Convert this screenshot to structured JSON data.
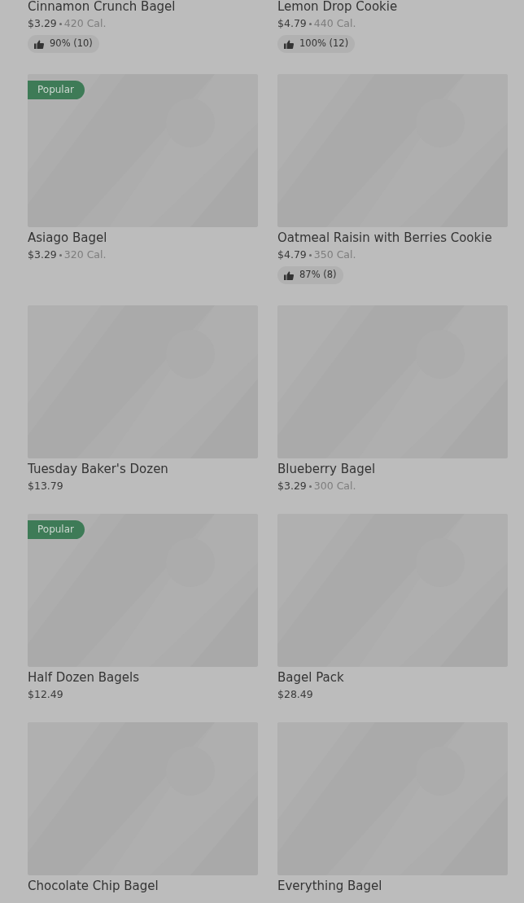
{
  "items": [
    {
      "name": "Cinnamon Crunch Bagel",
      "price": "$3.29",
      "calories": "420 Cal.",
      "rating": "90% (10)"
    },
    {
      "name": "Lemon Drop Cookie",
      "price": "$4.79",
      "calories": "440 Cal.",
      "rating": "100% (12)"
    },
    {
      "badge": "Popular",
      "name": "Asiago Bagel",
      "price": "$3.29",
      "calories": "320 Cal."
    },
    {
      "name": "Oatmeal Raisin with Berries Cookie",
      "price": "$4.79",
      "calories": "350 Cal.",
      "rating": "87% (8)"
    },
    {
      "name": "Tuesday Baker's Dozen",
      "price": "$13.79"
    },
    {
      "name": "Blueberry Bagel",
      "price": "$3.29",
      "calories": "300 Cal."
    },
    {
      "badge": "Popular",
      "name": "Half Dozen Bagels",
      "price": "$12.49"
    },
    {
      "name": "Bagel Pack",
      "price": "$28.49"
    },
    {
      "name": "Chocolate Chip Bagel"
    },
    {
      "name": "Everything Bagel"
    }
  ]
}
